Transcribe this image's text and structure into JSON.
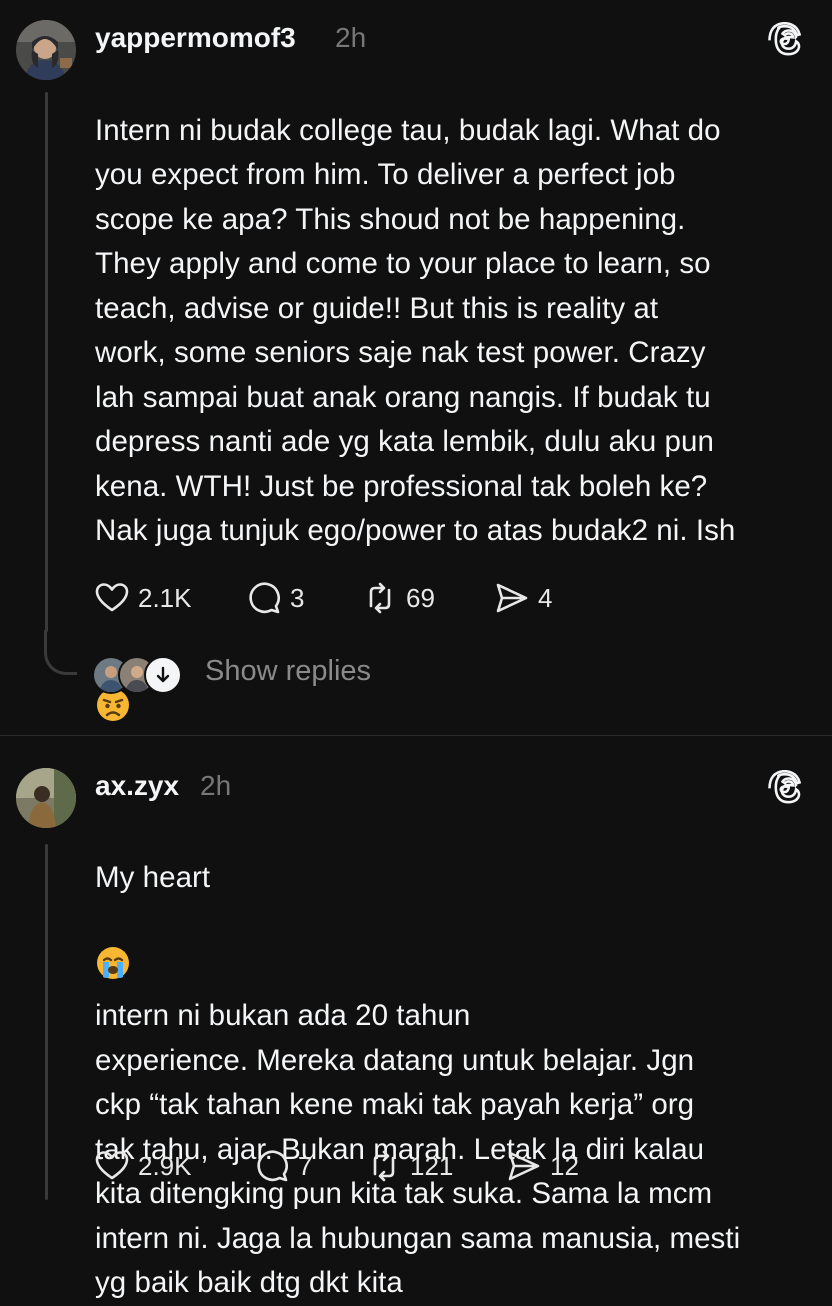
{
  "posts": [
    {
      "username": "yappermomof3",
      "time": "2h",
      "text": "Intern ni budak college tau, budak lagi. What do\nyou expect from him. To deliver a perfect job\nscope ke apa? This shoud not be happening.\nThey apply and come to your place to learn, so\nteach, advise or guide!! But this is reality at\nwork, some seniors saje nak test power. Crazy\nlah sampai buat anak orang nangis. If budak tu\ndepress nanti ade yg kata lembik, dulu aku pun\nkena. WTH! Just be professional tak boleh ke?\nNak juga tunjuk ego/power to atas budak2 ni. Ish",
      "emoji": "angry-face",
      "likes": "2.1K",
      "comments": "3",
      "reposts": "69",
      "shares": "4",
      "show_replies": "Show replies"
    },
    {
      "username": "ax.zyx",
      "time": "2h",
      "text_prefix": "My heart",
      "emoji": "loudly-crying-face",
      "text": "intern ni bukan ada 20 tahun\nexperience. Mereka datang untuk belajar. Jgn\nckp “tak tahan kene maki tak payah kerja” org\ntak tahu, ajar.  Bukan marah. Letak la diri kalau\nkita ditengking pun kita tak suka. Sama la mcm\nintern ni. Jaga la hubungan sama manusia, mesti\nyg baik baik dtg dkt kita",
      "likes": "2.9K",
      "comments": "7",
      "reposts": "121",
      "shares": "12"
    }
  ],
  "icons": {
    "like": "heart-icon",
    "comment": "comment-icon",
    "repost": "repost-icon",
    "share": "share-icon",
    "threads": "threads-logo-icon"
  },
  "colors": {
    "background": "#101010",
    "text": "#f3f5f7",
    "muted": "#777777"
  }
}
